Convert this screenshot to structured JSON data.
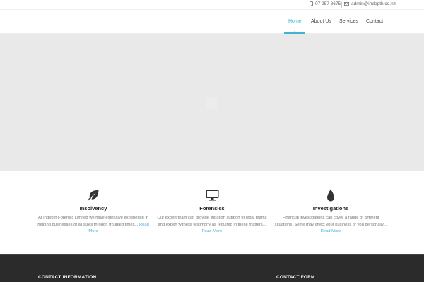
{
  "topbar": {
    "phone": "07 957 8675",
    "email": "admin@indepth.co.nz",
    "phone_icon": "mobile-phone-icon",
    "email_icon": "envelope-icon"
  },
  "nav": {
    "items": [
      {
        "label": "Home",
        "active": true
      },
      {
        "label": "About Us",
        "active": false
      },
      {
        "label": "Services",
        "active": false
      },
      {
        "label": "Contact",
        "active": false
      }
    ],
    "accent_color": "#43b3d4"
  },
  "features": [
    {
      "icon": "leaf-icon",
      "title": "Insolvency",
      "text": "At Indepth Forensic Limited we have extensive experience in helping businesses of all sizes through troubled times...",
      "link": "Read More"
    },
    {
      "icon": "monitor-icon",
      "title": "Forensics",
      "text": "Our expert team can provide litigation support to legal teams and expert witness testimony as required in these matters...",
      "link": "Read More"
    },
    {
      "icon": "drop-icon",
      "title": "Investigations",
      "text": "Financial investigations can cover a range of different situations. Some may affect your business or you personally...",
      "link": "Read More"
    }
  ],
  "footer": {
    "contact_info_title": "CONTACT INFORMATION",
    "contact_form_title": "CONTACT FORM",
    "background_color": "#2b2b2b"
  }
}
